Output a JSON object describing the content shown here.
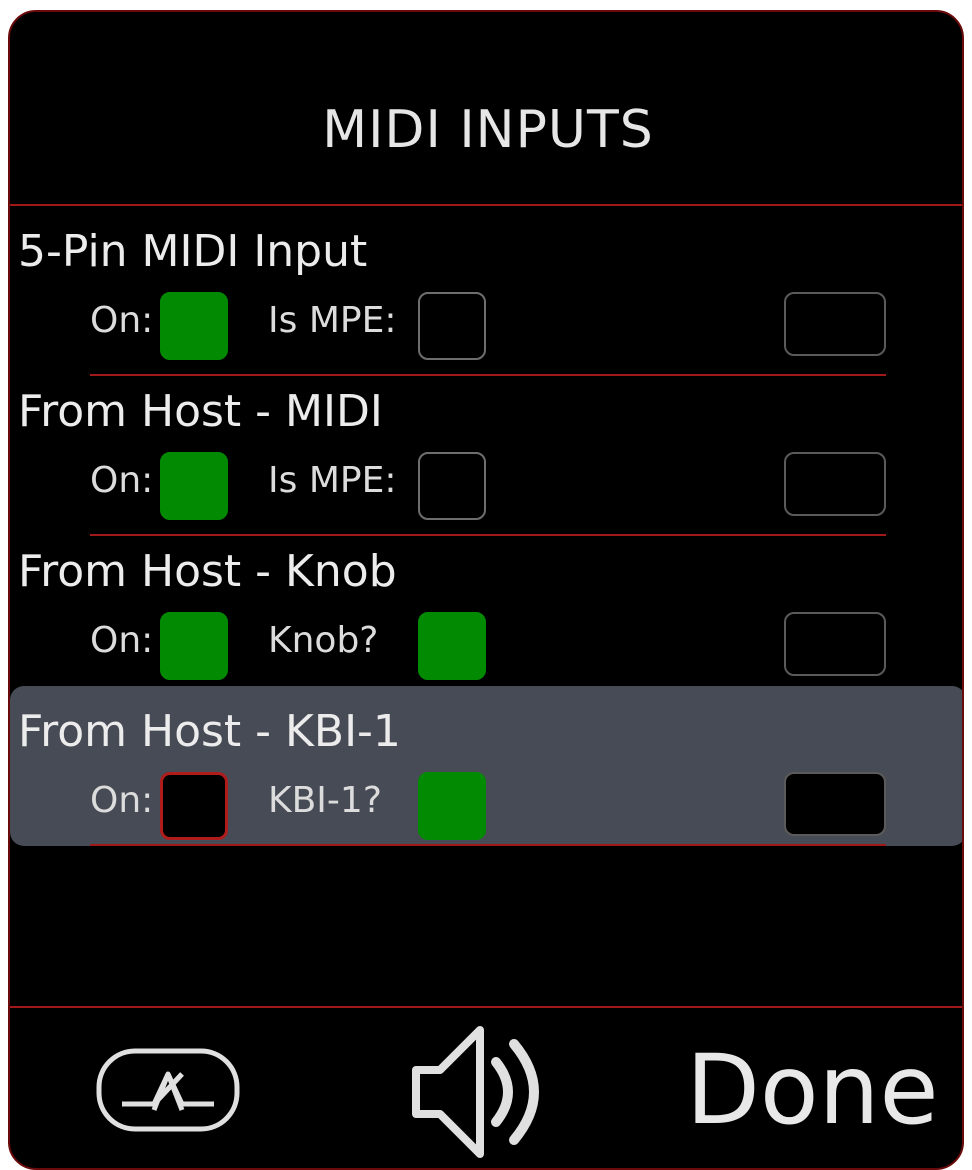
{
  "header": {
    "title": "MIDI INPUTS"
  },
  "inputs": [
    {
      "name": "5-Pin MIDI Input",
      "on_label": "On:",
      "on": true,
      "option_label": "Is MPE:",
      "option": false,
      "selected": false
    },
    {
      "name": "From Host - MIDI",
      "on_label": "On:",
      "on": true,
      "option_label": "Is MPE:",
      "option": false,
      "selected": false
    },
    {
      "name": "From Host - Knob",
      "on_label": "On:",
      "on": true,
      "option_label": "Knob?",
      "option": true,
      "selected": false
    },
    {
      "name": "From Host - KBI-1",
      "on_label": "On:",
      "on": false,
      "option_label": "KBI-1?",
      "option": true,
      "selected": true
    }
  ],
  "footer": {
    "bluetooth_icon": "bluetooth-icon",
    "speaker_icon": "speaker-icon",
    "done_label": "Done"
  },
  "colors": {
    "background": "#000000",
    "accent_line": "#a01818",
    "on_green": "#028b02",
    "selected_row": "#474b55",
    "text": "#e6e6e6"
  }
}
